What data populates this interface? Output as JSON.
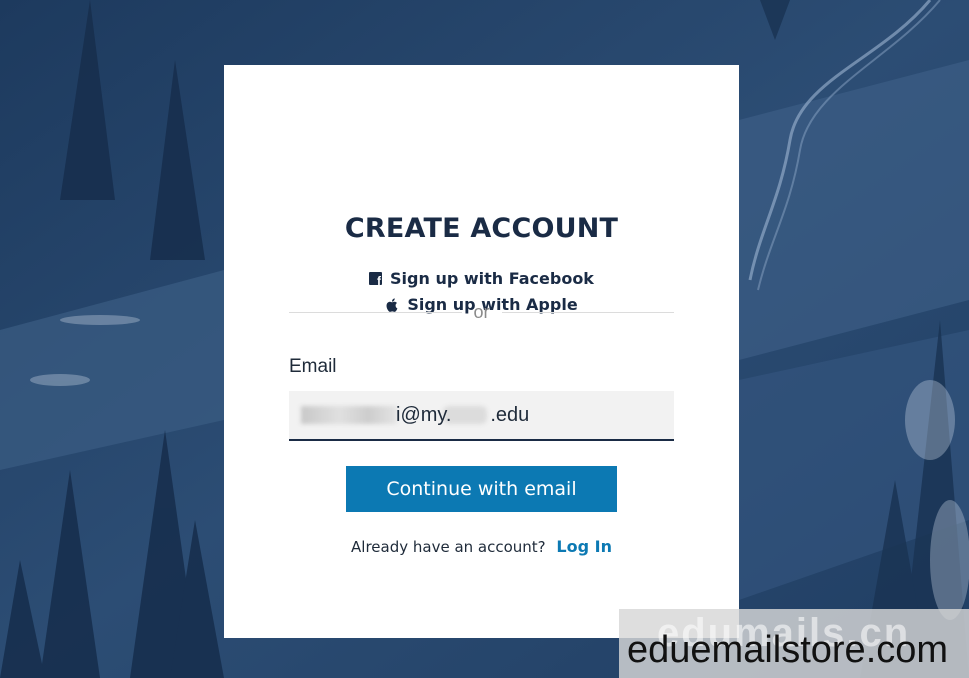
{
  "card": {
    "title": "CREATE ACCOUNT",
    "social": {
      "facebook_label": "Sign up with Facebook",
      "facebook_icon": "facebook-icon",
      "apple_label": "Sign up with Apple",
      "apple_icon": "apple-icon"
    },
    "divider_text": "or",
    "email": {
      "label": "Email",
      "value_visible": "i@my.       .edu"
    },
    "continue_label": "Continue with email",
    "login": {
      "prompt": "Already have an account?",
      "link_label": "Log In"
    }
  },
  "watermark": {
    "ghost": "edumails.cn",
    "brand": "eduemailstore.com"
  },
  "colors": {
    "primary_button": "#0c79b3",
    "heading": "#1a2b45",
    "background": "#27456a"
  }
}
